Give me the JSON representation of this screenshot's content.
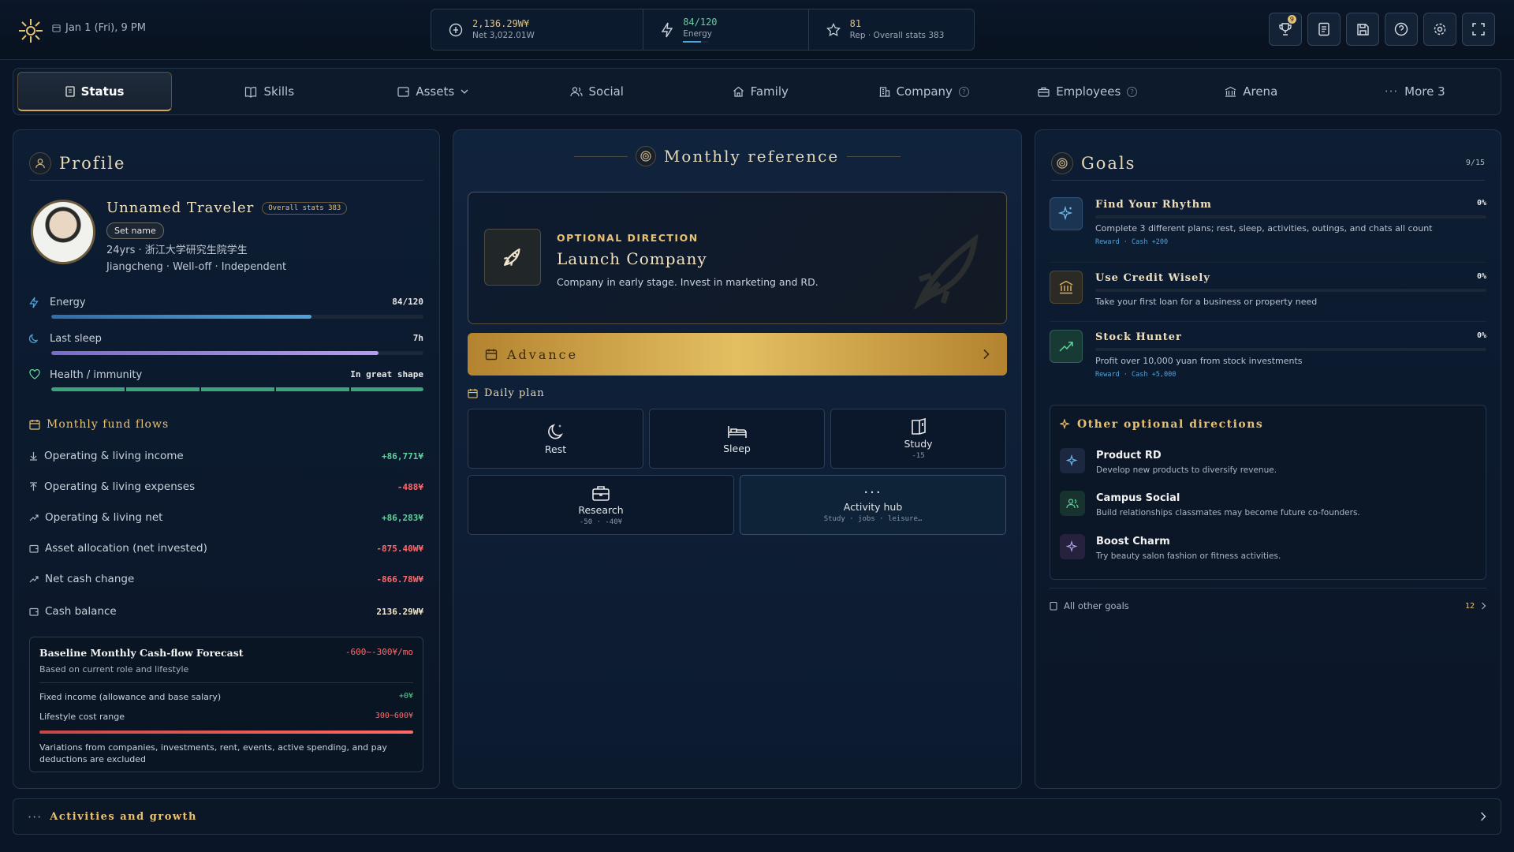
{
  "topbar": {
    "date": "Jan 1 (Fri), 9 PM",
    "cash": "2,136.29W¥",
    "net": "Net 3,022.01W",
    "energy_value": "84/120",
    "energy_label": "Energy",
    "energy_fraction": 0.7,
    "rep_value": "81",
    "rep_label": "Rep · Overall stats 383",
    "trophy_badge": "9"
  },
  "tabs": {
    "status": "Status",
    "skills": "Skills",
    "assets": "Assets",
    "social": "Social",
    "family": "Family",
    "company": "Company",
    "employees": "Employees",
    "arena": "Arena",
    "more": "More 3"
  },
  "profile": {
    "title": "Profile",
    "name": "Unnamed Traveler",
    "overall": "Overall stats 383",
    "set_name": "Set name",
    "line1": "24yrs · 浙江大学研究生院学生",
    "line2": "Jiangcheng · Well-off · Independent",
    "energy_label": "Energy",
    "energy_value": "84/120",
    "energy_fraction": 0.7,
    "sleep_label": "Last sleep",
    "sleep_value": "7h",
    "sleep_fraction": 0.88,
    "health_label": "Health / immunity",
    "health_value": "In great shape",
    "health_fraction": 1.0
  },
  "funds": {
    "title": "Monthly fund flows",
    "rows": [
      {
        "label": "Operating & living income",
        "value": "+86,771¥"
      },
      {
        "label": "Operating & living expenses",
        "value": "-488¥"
      },
      {
        "label": "Operating & living net",
        "value": "+86,283¥"
      },
      {
        "label": "Asset allocation (net invested)",
        "value": "-875.40W¥"
      },
      {
        "label": "Net cash change",
        "value": "-866.78W¥"
      },
      {
        "label": "Cash balance",
        "value": "2136.29W¥"
      }
    ]
  },
  "forecast": {
    "title": "Baseline Monthly Cash-flow Forecast",
    "range": "-600~-300¥/mo",
    "subtitle": "Based on current role and lifestyle",
    "fixed_label": "Fixed income (allowance and base salary)",
    "fixed_value": "+0¥",
    "lifestyle_label": "Lifestyle cost range",
    "lifestyle_value": "300~600¥",
    "note": "Variations from companies, investments, rent, events, active spending, and pay deductions are excluded"
  },
  "monthly": {
    "title": "Monthly reference",
    "kicker": "OPTIONAL DIRECTION",
    "direction": "Launch Company",
    "desc": "Company in early stage. Invest in marketing and RD.",
    "advance": "Advance",
    "daily_plan": "Daily plan",
    "rest": "Rest",
    "sleep": "Sleep",
    "study": "Study",
    "study_sub": "-15",
    "research": "Research",
    "research_sub": "-50 · -40¥",
    "hub": "Activity hub",
    "hub_sub": "Study · jobs · leisure…"
  },
  "goals": {
    "title": "Goals",
    "count": "9/15",
    "items": [
      {
        "title": "Find Your Rhythm",
        "pct": "0%",
        "desc": "Complete 3 different plans; rest, sleep, activities, outings, and chats all count",
        "reward": "Reward · Cash +200"
      },
      {
        "title": "Use Credit Wisely",
        "pct": "0%",
        "desc": "Take your first loan for a business or property need",
        "reward": ""
      },
      {
        "title": "Stock Hunter",
        "pct": "0%",
        "desc": "Profit over 10,000 yuan from stock investments",
        "reward": "Reward · Cash +5,000"
      }
    ],
    "other_title": "Other optional directions",
    "other": [
      {
        "title": "Product RD",
        "desc": "Develop new products to diversify revenue."
      },
      {
        "title": "Campus Social",
        "desc": "Build relationships classmates may become future co-founders."
      },
      {
        "title": "Boost Charm",
        "desc": "Try beauty salon fashion or fitness activities."
      }
    ],
    "all_other": "All other goals",
    "all_other_count": "12"
  },
  "bottom": {
    "label": "Activities and growth"
  },
  "colors": {
    "gold": "#e8c170",
    "green": "#5fd39b",
    "red": "#ff6a6a",
    "background": "#0a1628"
  }
}
